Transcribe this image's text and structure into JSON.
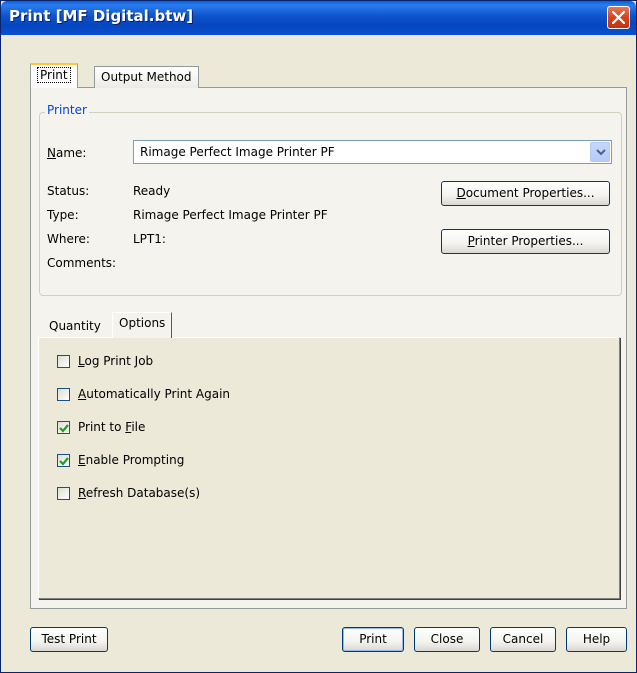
{
  "window": {
    "title": "Print [MF Digital.btw]"
  },
  "tabs": [
    {
      "label": "Print",
      "active": true
    },
    {
      "label": "Output Method",
      "active": false
    }
  ],
  "printer": {
    "group_title": "Printer",
    "name_label_accel": "N",
    "name_label_rest": "ame:",
    "name_value": "Rimage Perfect Image Printer PF",
    "status_label": "Status:",
    "status_value": "Ready",
    "type_label": "Type:",
    "type_value": "Rimage Perfect Image Printer PF",
    "where_label": "Where:",
    "where_value": "LPT1:",
    "comments_label": "Comments:",
    "comments_value": "",
    "document_properties_accel": "D",
    "document_properties_rest": "ocument Properties...",
    "printer_properties_accel": "P",
    "printer_properties_rest": "rinter Properties..."
  },
  "subtabs": [
    {
      "label": "Quantity",
      "active": false
    },
    {
      "label": "Options",
      "active": true
    }
  ],
  "options": [
    {
      "pre": "",
      "accel": "L",
      "post": "og Print Job",
      "checked": false
    },
    {
      "pre": "",
      "accel": "A",
      "post": "utomatically Print Again",
      "checked": false
    },
    {
      "pre": "Print to ",
      "accel": "F",
      "post": "ile",
      "checked": true
    },
    {
      "pre": "",
      "accel": "E",
      "post": "nable Prompting",
      "checked": true
    },
    {
      "pre": "",
      "accel": "R",
      "post": "efresh Database(s)",
      "checked": false
    }
  ],
  "footer": {
    "test_print": "Test Print",
    "print": "Print",
    "close": "Close",
    "cancel": "Cancel",
    "help": "Help"
  },
  "colors": {
    "accent": "#0046d5",
    "titlebar": "#0546bf",
    "check": "#21a121"
  }
}
